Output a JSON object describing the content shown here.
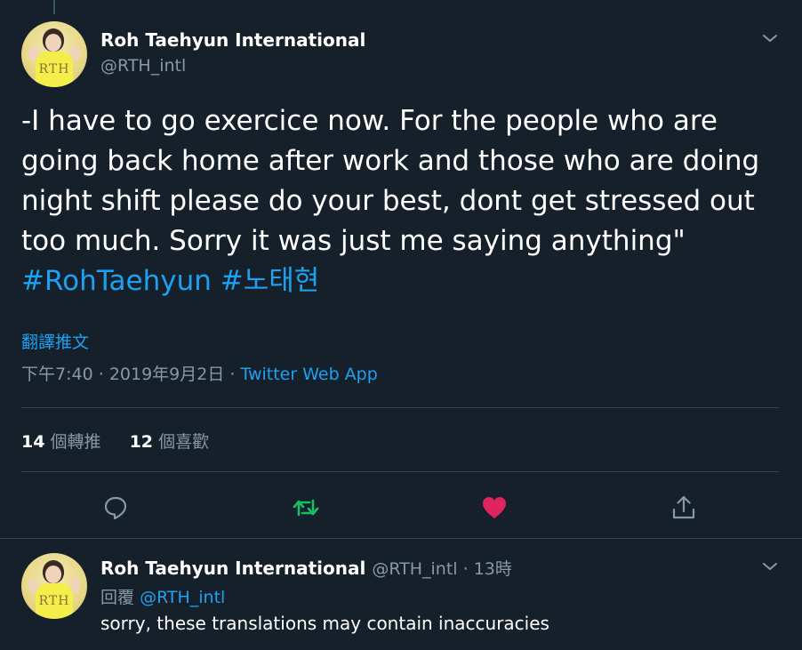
{
  "tweet": {
    "display_name": "Roh Taehyun International",
    "handle": "@RTH_intl",
    "avatar_logo": "RTH",
    "text": "-I have to go exercice now. For the people who are going back home after work and those who are doing night shift please do your best, dont get stressed out too much. Sorry it was just me saying anything\"",
    "hashtags": [
      "#RohTaehyun",
      "#노태현"
    ],
    "translate_label": "翻譯推文",
    "time": "下午7:40",
    "date": "2019年9月2日",
    "meta_sep": "·",
    "source": "Twitter Web App",
    "stats": {
      "retweet_count": "14",
      "retweet_label": "個轉推",
      "like_count": "12",
      "like_label": "個喜歡"
    },
    "actions": {
      "reply_icon": "reply-icon",
      "retweet_icon": "retweet-icon",
      "like_icon": "heart-icon",
      "share_icon": "share-icon",
      "retweet_color": "#17bf63",
      "like_color": "#e0245e"
    }
  },
  "reply": {
    "display_name": "Roh Taehyun International",
    "handle": "@RTH_intl",
    "sep": "·",
    "time_ago": "13時",
    "replying_prefix": "回覆",
    "replying_to": "@RTH_intl",
    "text": "sorry, these translations may contain inaccuracies"
  },
  "colors": {
    "background": "#15202b",
    "accent": "#1da1f2",
    "muted": "#8899a6",
    "divider": "#38444d"
  }
}
